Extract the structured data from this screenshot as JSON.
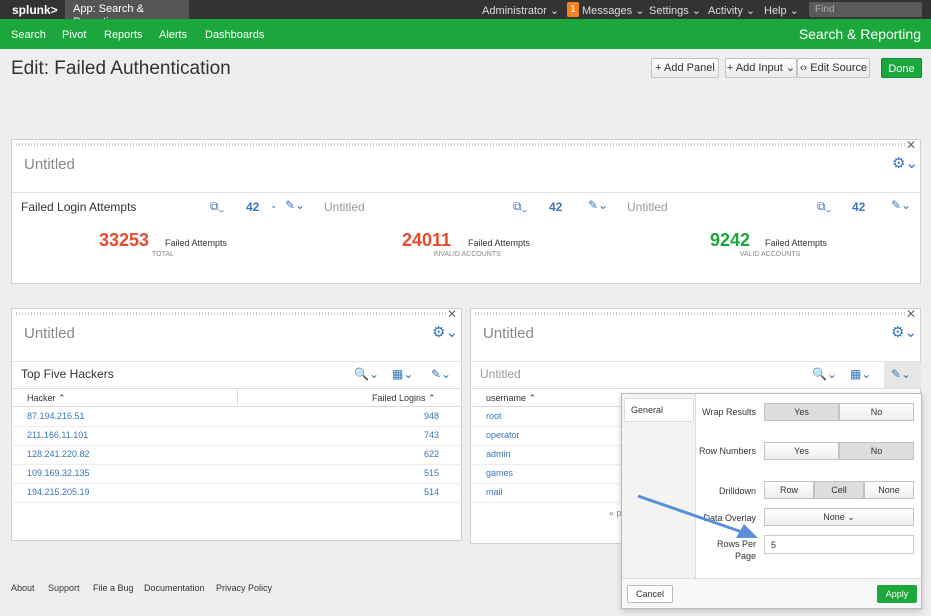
{
  "topbar": {
    "logo": "splunk>",
    "app": "App: Search & Reporting ⌄",
    "admin": "Administrator ⌄",
    "badge": "1",
    "messages": "Messages ⌄",
    "settings": "Settings ⌄",
    "activity": "Activity ⌄",
    "help": "Help ⌄",
    "find": "Find"
  },
  "nav": {
    "items": [
      "Search",
      "Pivot",
      "Reports",
      "Alerts",
      "Dashboards"
    ],
    "title": "Search & Reporting"
  },
  "page": {
    "title": "Edit: Failed Authentication",
    "add_panel": "+ Add Panel",
    "add_input": "+ Add Input ⌄",
    "edit_source": "‹› Edit Source",
    "done": "Done"
  },
  "panel1": {
    "title": "Untitled",
    "s1": "Failed Login Attempts",
    "s2": "Untitled",
    "s3": "Untitled",
    "count": "42",
    "v1": "33253",
    "l1": "Failed Attempts",
    "sub1": "TOTAL",
    "v2": "24011",
    "l2": "Failed Attempts",
    "sub2": "INVALID ACCOUNTS",
    "v3": "9242",
    "l3": "Failed Attempts",
    "sub3": "VALID ACCOUNTS"
  },
  "panel2": {
    "title": "Untitled",
    "sub": "Top Five Hackers",
    "col1": "Hacker ⌃",
    "col2": "Failed Logins ⌃",
    "rows": [
      [
        "87.194.216.51",
        "948"
      ],
      [
        "211.166.11.101",
        "743"
      ],
      [
        "128.241.220.82",
        "622"
      ],
      [
        "109.169.32.135",
        "515"
      ],
      [
        "194.215.205.19",
        "514"
      ]
    ]
  },
  "panel3": {
    "title": "Untitled",
    "sub": "Untitled",
    "col1": "username ⌃",
    "rows": [
      "root",
      "operator",
      "admin",
      "games",
      "mail"
    ],
    "prev": "« p"
  },
  "popup": {
    "tab": "General",
    "wrap": "Wrap Results",
    "rownum": "Row Numbers",
    "drill": "Drilldown",
    "overlay": "Data Overlay",
    "rpp": "Rows Per Page",
    "yes": "Yes",
    "no": "No",
    "row": "Row",
    "cell": "Cell",
    "none": "None",
    "none_dd": "None ⌄",
    "rpp_val": "5",
    "cancel": "Cancel",
    "apply": "Apply"
  },
  "footer": [
    "About",
    "Support",
    "File a Bug",
    "Documentation",
    "Privacy Policy"
  ],
  "colors": {
    "red": "#e84a2b",
    "green": "#1ca73c",
    "blue": "#3776b6"
  }
}
